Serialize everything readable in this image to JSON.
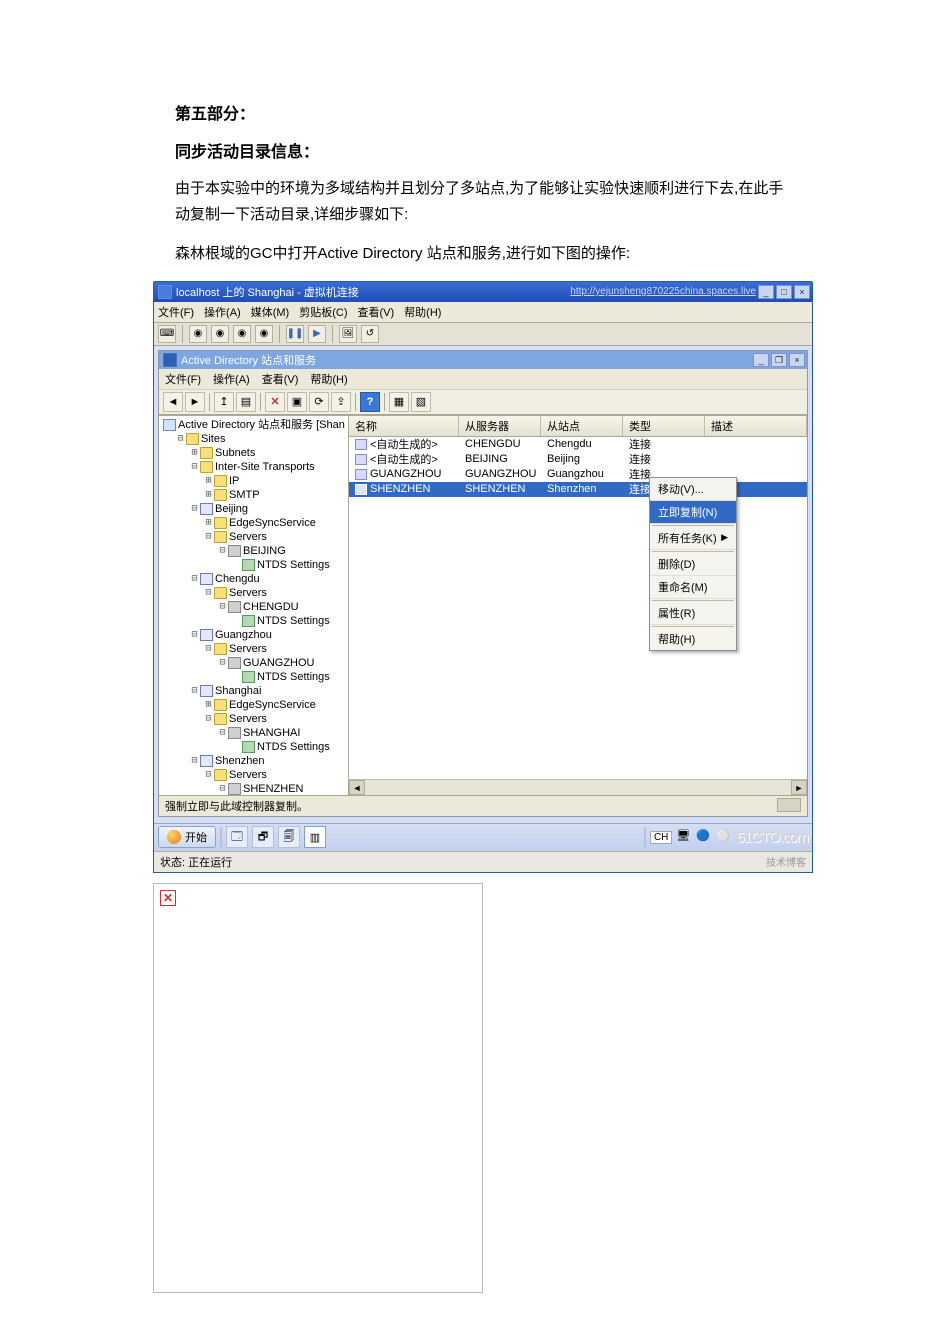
{
  "doc": {
    "heading1": "第五部分：",
    "heading2": "同步活动目录信息：",
    "para1": "由于本实验中的环境为多域结构并且划分了多站点,为了能够让实验快速顺利进行下去,在此手动复制一下活动目录,详细步骤如下:",
    "para2": "森林根域的GC中打开Active Directory 站点和服务,进行如下图的操作:"
  },
  "vm": {
    "title": "localhost 上的 Shanghai - 虚拟机连接",
    "url": "http://yejunsheng870225china.spaces.live",
    "menu": [
      "文件(F)",
      "操作(A)",
      "媒体(M)",
      "剪贴板(C)",
      "查看(V)",
      "帮助(H)"
    ],
    "status": "状态: 正在运行",
    "brand": "51CTO.com",
    "brand_sub": "技术博客"
  },
  "ad": {
    "title": "Active Directory 站点和服务",
    "menu": [
      "文件(F)",
      "操作(A)",
      "查看(V)",
      "帮助(H)"
    ],
    "tree_root": "Active Directory 站点和服务 [Shan",
    "sites": "Sites",
    "subnets": "Subnets",
    "ist": "Inter-Site Transports",
    "ip": "IP",
    "smtp": "SMTP",
    "beijing": "Beijing",
    "edgesync": "EdgeSyncService",
    "servers": "Servers",
    "server_beijing": "BEIJING",
    "ntds": "NTDS Settings",
    "chengdu": "Chengdu",
    "server_chengdu": "CHENGDU",
    "guangzhou": "Guangzhou",
    "server_guangzhou": "GUANGZHOU",
    "shanghai": "Shanghai",
    "server_shanghai": "SHANGHAI",
    "shenzhen": "Shenzhen",
    "server_shenzhen": "SHENZHEN",
    "cols": {
      "name": "名称",
      "server": "从服务器",
      "site": "从站点",
      "type": "类型",
      "desc": "描述"
    },
    "rows": [
      {
        "name": "<自动生成的>",
        "server": "CHENGDU",
        "site": "Chengdu",
        "type": "连接"
      },
      {
        "name": "<自动生成的>",
        "server": "BEIJING",
        "site": "Beijing",
        "type": "连接"
      },
      {
        "name": "GUANGZHOU",
        "server": "GUANGZHOU",
        "site": "Guangzhou",
        "type": "连接"
      },
      {
        "name": "SHENZHEN",
        "server": "SHENZHEN",
        "site": "Shenzhen",
        "type": "连接"
      }
    ],
    "ctx": {
      "move": "移动(V)...",
      "replicate": "立即复制(N)",
      "alltasks": "所有任务(K)",
      "delete": "删除(D)",
      "rename": "重命名(M)",
      "props": "属性(R)",
      "help": "帮助(H)"
    },
    "status": "强制立即与此域控制器复制。"
  },
  "taskbar": {
    "start": "开始",
    "lang": "CH"
  }
}
